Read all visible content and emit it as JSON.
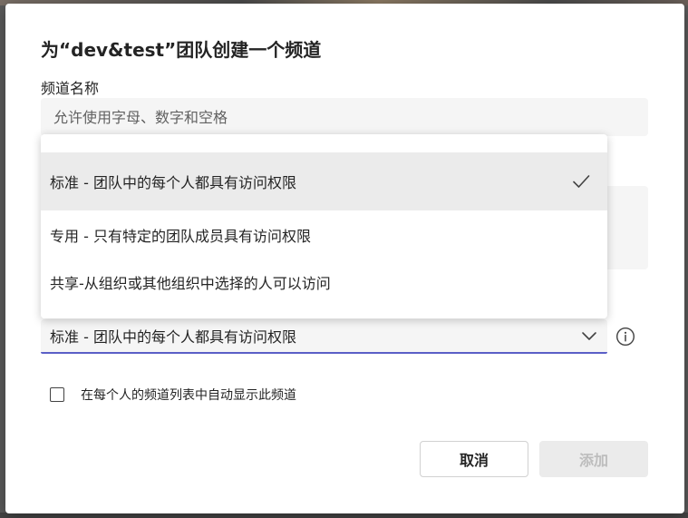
{
  "dialog": {
    "title": "为“dev&test”团队创建一个频道",
    "name_label": "频道名称",
    "name_placeholder": "允许使用字母、数字和空格",
    "name_value": ""
  },
  "privacy": {
    "options": [
      {
        "label": "标准 - 团队中的每个人都具有访问权限",
        "selected": true
      },
      {
        "label": "专用 - 只有特定的团队成员具有访问权限",
        "selected": false
      },
      {
        "label": "共享-从组织或其他组织中选择的人可以访问",
        "selected": false
      }
    ],
    "selected_label": "标准 - 团队中的每个人都具有访问权限"
  },
  "auto_show": {
    "label": "在每个人的频道列表中自动显示此频道",
    "checked": false
  },
  "buttons": {
    "cancel": "取消",
    "add": "添加"
  },
  "icons": {
    "check": "checkmark-icon",
    "chevron": "chevron-down-icon",
    "info": "info-icon"
  },
  "colors": {
    "accent": "#5b5fc7",
    "field_bg": "#f5f5f5",
    "selected_bg": "#ebebeb",
    "disabled_text": "#bdbdbd"
  }
}
